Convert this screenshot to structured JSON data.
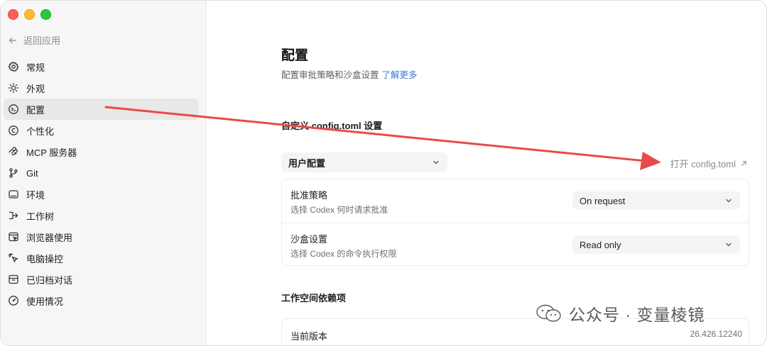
{
  "sidebar": {
    "back_label": "返回应用",
    "items": [
      {
        "label": "常规",
        "icon": "gear-icon"
      },
      {
        "label": "外观",
        "icon": "sun-icon"
      },
      {
        "label": "配置",
        "icon": "config-icon",
        "active": true
      },
      {
        "label": "个性化",
        "icon": "personalize-icon"
      },
      {
        "label": "MCP 服务器",
        "icon": "mcp-icon"
      },
      {
        "label": "Git",
        "icon": "git-branch-icon"
      },
      {
        "label": "环境",
        "icon": "environment-icon"
      },
      {
        "label": "工作树",
        "icon": "worktree-icon"
      },
      {
        "label": "浏览器使用",
        "icon": "browser-icon"
      },
      {
        "label": "电脑操控",
        "icon": "pointer-icon"
      },
      {
        "label": "已归档对话",
        "icon": "archive-icon"
      },
      {
        "label": "使用情况",
        "icon": "gauge-icon"
      }
    ]
  },
  "main": {
    "title": "配置",
    "subtitle": "配置审批策略和沙盒设置",
    "learn_more": "了解更多",
    "custom_section_title": "自定义 config.toml 设置",
    "profile_select": "用户配置",
    "open_config": "打开 config.toml",
    "settings": [
      {
        "label": "批准策略",
        "description": "选择 Codex 何时请求批准",
        "value": "On request"
      },
      {
        "label": "沙盒设置",
        "description": "选择 Codex 的命令执行权限",
        "value": "Read only"
      }
    ],
    "workspace_section_title": "工作空间依赖项",
    "current_version_label": "当前版本",
    "current_version_value": "26.426.12240"
  },
  "watermark": {
    "text": "公众号 · 变量棱镜"
  },
  "colors": {
    "accent_link": "#3a7bd5",
    "annotation_arrow": "#e84a4a",
    "sidebar_bg": "#f6f6f6",
    "active_item_bg": "#e8e8e8"
  }
}
